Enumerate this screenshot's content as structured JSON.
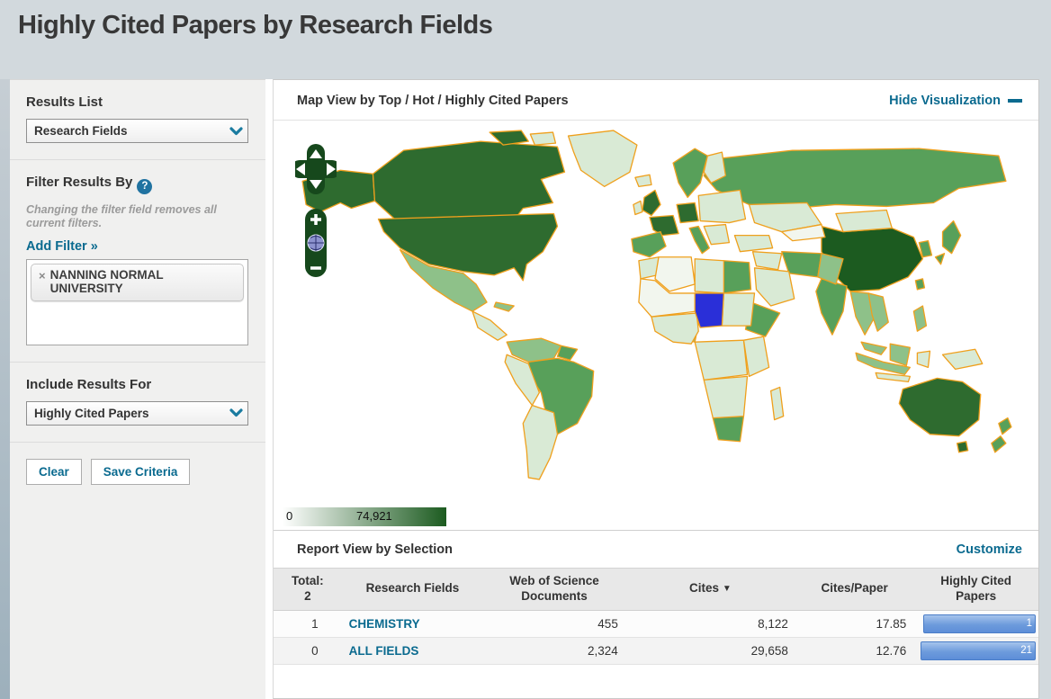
{
  "page": {
    "title": "Highly Cited Papers by Research Fields"
  },
  "sidebar": {
    "results_list": {
      "label": "Results List",
      "selected": "Research Fields"
    },
    "filter": {
      "label": "Filter Results By",
      "help_icon": "?",
      "note": "Changing the filter field removes all current filters.",
      "add_filter_label": "Add Filter »",
      "tag": {
        "remove_icon": "×",
        "label": "NANNING NORMAL UNIVERSITY"
      }
    },
    "include_results": {
      "label": "Include Results For",
      "selected": "Highly Cited Papers"
    },
    "buttons": {
      "clear": "Clear",
      "save": "Save Criteria"
    }
  },
  "map_section": {
    "title": "Map View by Top / Hot / Highly Cited Papers",
    "hide_link": "Hide Visualization",
    "controls": {
      "zoom_in": "+",
      "zoom_out": "−"
    },
    "legend": {
      "min": "0",
      "max": "74,921"
    },
    "selected_country": "Chad (highlighted blue)"
  },
  "report": {
    "title": "Report View by Selection",
    "customize_link": "Customize",
    "table": {
      "total_label": "Total:",
      "total_value": "2",
      "columns": {
        "field": "Research Fields",
        "docs_line1": "Web of Science",
        "docs_line2": "Documents",
        "cites": "Cites",
        "cites_sort_arrow": "▼",
        "cpp": "Cites/Paper",
        "hcp_line1": "Highly Cited",
        "hcp_line2": "Papers"
      },
      "rows": [
        {
          "rank": "1",
          "field": "CHEMISTRY",
          "documents": "455",
          "cites": "8,122",
          "cites_per_paper": "17.85",
          "highly_cited": "1",
          "bar_pct": 98
        },
        {
          "rank": "0",
          "field": "ALL FIELDS",
          "documents": "2,324",
          "cites": "29,658",
          "cites_per_paper": "12.76",
          "highly_cited": "21",
          "bar_pct": 100
        }
      ]
    }
  },
  "colors": {
    "teal": "#0a6a8f",
    "cites-blue": "#6e93cc",
    "map-darkest": "#1c5b20",
    "map-dark": "#2e6b2f",
    "map-med": "#58a05a",
    "map-light": "#8ec189",
    "map-pale": "#d9ead5",
    "map-blue": "#2a2fd8",
    "map-border": "#efa01d",
    "bar-top": "#a6c4ec",
    "bar-bot": "#5d8ed8"
  }
}
